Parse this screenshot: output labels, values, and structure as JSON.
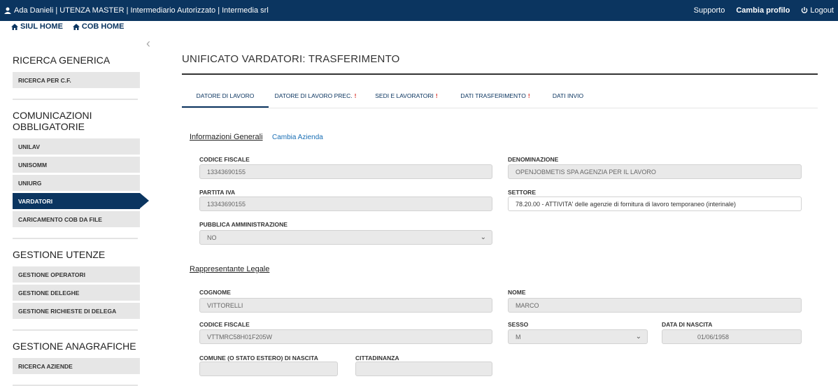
{
  "topbar": {
    "user": "Ada Danieli | UTENZA MASTER | Intermediario Autorizzato | Intermedia srl",
    "support": "Supporto",
    "change_profile": "Cambia profilo",
    "logout": "Logout",
    "bg": "#0b3560"
  },
  "home": {
    "siul": "SIUL HOME",
    "cob": "COB HOME"
  },
  "sidebar": {
    "s1": {
      "title": "RICERCA GENERICA",
      "items": [
        "RICERCA PER C.F."
      ]
    },
    "s2": {
      "title": "COMUNICAZIONI OBBLIGATORIE",
      "items": [
        "UNILAV",
        "UNISOMM",
        "UNIURG",
        "VARDATORI",
        "CARICAMENTO COB DA FILE"
      ]
    },
    "s3": {
      "title": "GESTIONE UTENZE",
      "items": [
        "GESTIONE OPERATORI",
        "GESTIONE DELEGHE",
        "GESTIONE RICHIESTE DI DELEGA"
      ]
    },
    "s4": {
      "title": "GESTIONE ANAGRAFICHE",
      "items": [
        "RICERCA AZIENDE"
      ]
    }
  },
  "main": {
    "title": "UNIFICATO VARDATORI: TRASFERIMENTO",
    "tabs": [
      "DATORE DI LAVORO",
      "DATORE DI LAVORO PREC.",
      "SEDI E LAVORATORI",
      "DATI TRASFERIMENTO",
      "DATI INVIO"
    ],
    "warn": "!",
    "info_title": "Informazioni Generali",
    "change_company": "Cambia Azienda",
    "cf_label": "CODICE FISCALE",
    "cf_value": "13343690155",
    "den_label": "DENOMINAZIONE",
    "den_value": "OPENJOBMETIS SPA AGENZIA PER IL LAVORO",
    "piva_label": "PARTITA IVA",
    "piva_value": "13343690155",
    "settore_label": "SETTORE",
    "settore_value": "78.20.00 - ATTIVITA' delle agenzie di fornitura di lavoro temporaneo (interinale)",
    "pa_label": "PUBBLICA AMMINISTRAZIONE",
    "pa_value": "NO",
    "rl_title": "Rappresentante Legale",
    "cognome_label": "COGNOME",
    "cognome_value": "VITTORELLI",
    "nome_label": "NOME",
    "nome_value": "MARCO",
    "rl_cf_label": "CODICE FISCALE",
    "rl_cf_value": "VTTMRC58H01F205W",
    "sesso_label": "SESSO",
    "sesso_value": "M",
    "dn_label": "DATA DI NASCITA",
    "dn_value": "01/06/1958",
    "comune_label": "COMUNE (O STATO ESTERO) DI NASCITA",
    "citt_label": "CITTADINANZA"
  }
}
